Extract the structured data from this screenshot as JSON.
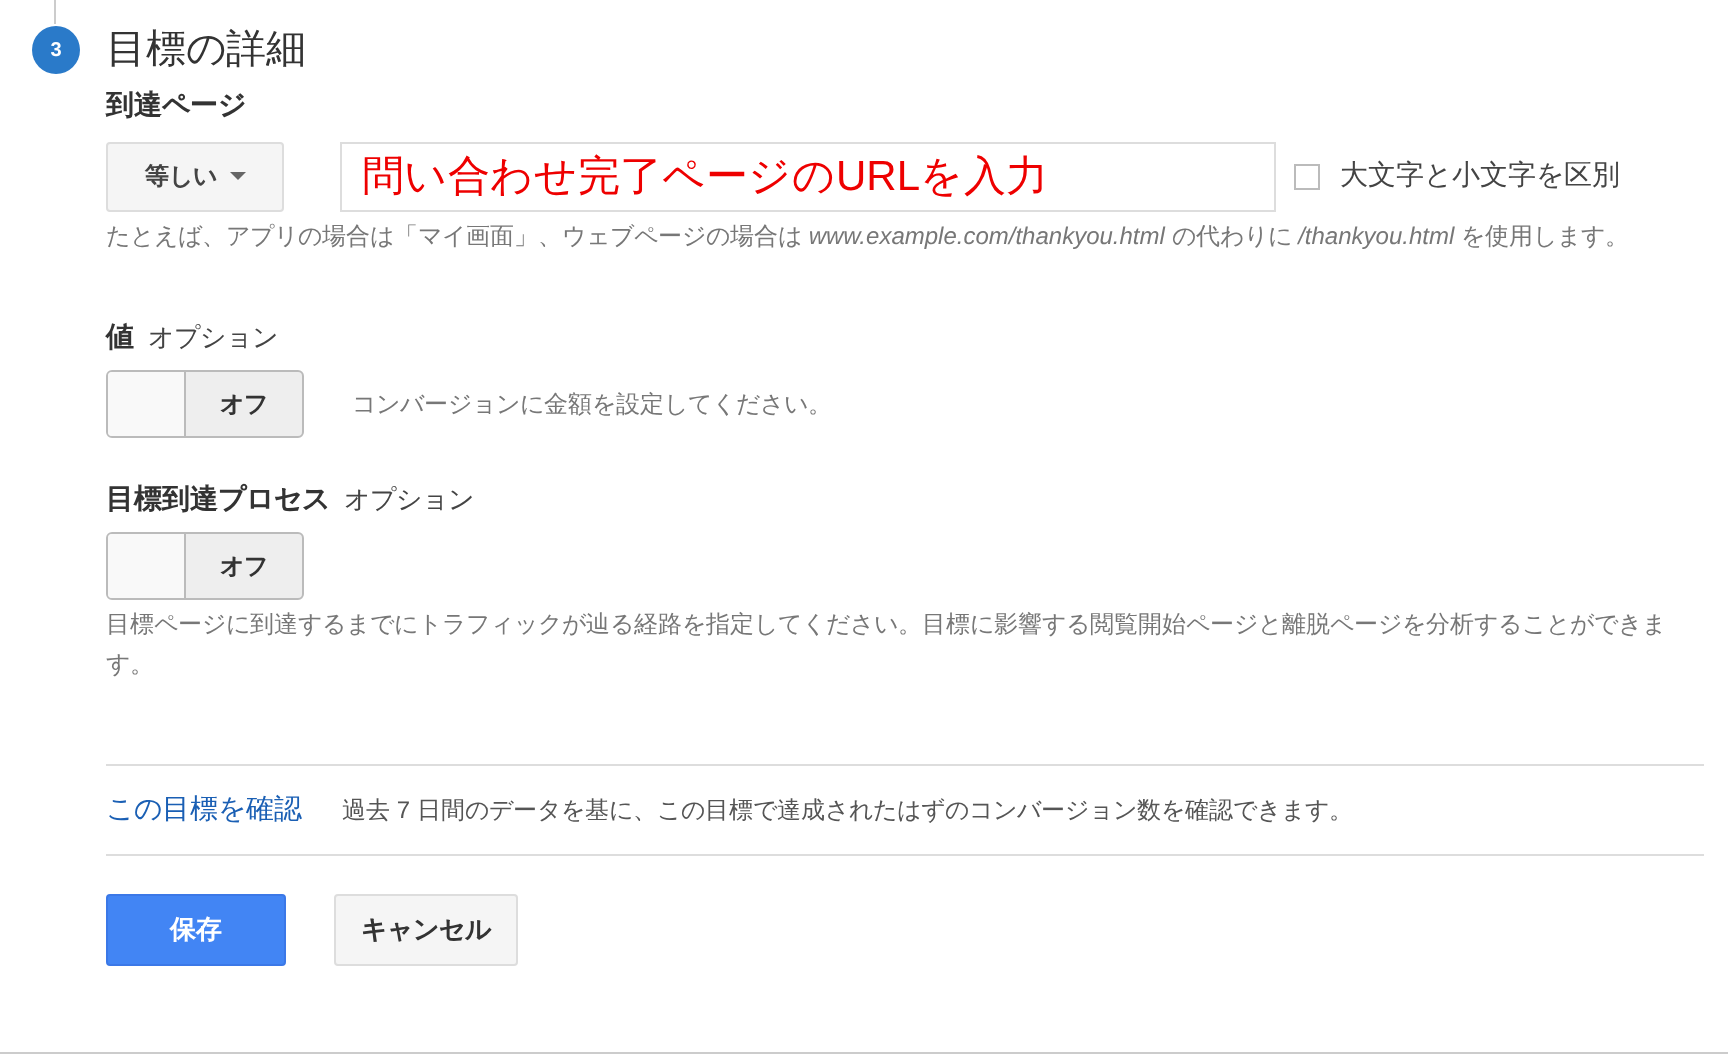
{
  "step": {
    "number": "3",
    "title": "目標の詳細"
  },
  "destination": {
    "label": "到達ページ",
    "match": "等しい",
    "url": "問い合わせ完了ページのURLを入力",
    "case_sensitive": {
      "label": "大文字と小文字を区別",
      "checked": false
    },
    "hint": "たとえば、アプリの場合は「マイ画面」、ウェブページの場合は *www.example.com/thankyou.html* の代わりに */thankyou.html* を使用します。"
  },
  "value": {
    "label": "値",
    "optional": "オプション",
    "toggle": {
      "label": "オフ",
      "on": false
    },
    "hint": "コンバージョンに金額を設定してください。"
  },
  "funnel": {
    "label": "目標到達プロセス",
    "optional": "オプション",
    "toggle": {
      "label": "オフ",
      "on": false
    },
    "hint": "目標ページに到達するまでにトラフィックが辿る経路を指定してください。目標に影響する閲覧開始ページと離脱ページを分析することができます。"
  },
  "verify": {
    "link": "この目標を確認",
    "text": "過去 7 日間のデータを基に、この目標で達成されたはずのコンバージョン数を確認できます。"
  },
  "buttons": [
    {
      "label": "保存",
      "kind": "primary"
    },
    {
      "label": "キャンセル",
      "kind": "secondary"
    }
  ]
}
